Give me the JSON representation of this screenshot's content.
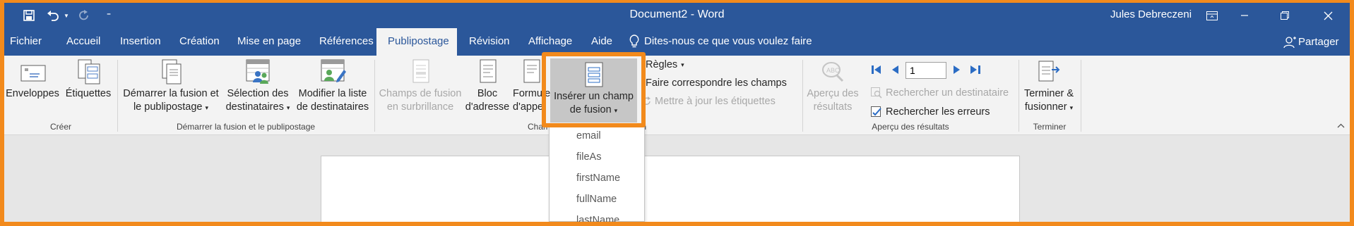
{
  "titlebar": {
    "doc_title": "Document2",
    "separator": "-",
    "app_name": "Word",
    "user": "Jules Debreczeni",
    "qat_customize": "⁼"
  },
  "tabs": [
    {
      "label": "Fichier",
      "active": false
    },
    {
      "label": "Accueil",
      "active": false
    },
    {
      "label": "Insertion",
      "active": false
    },
    {
      "label": "Création",
      "active": false
    },
    {
      "label": "Mise en page",
      "active": false
    },
    {
      "label": "Références",
      "active": false
    },
    {
      "label": "Publipostage",
      "active": true
    },
    {
      "label": "Révision",
      "active": false
    },
    {
      "label": "Affichage",
      "active": false
    },
    {
      "label": "Aide",
      "active": false
    }
  ],
  "tell_me": "Dites-nous ce que vous voulez faire",
  "share": "Partager",
  "ribbon": {
    "groups": {
      "creer": "Créer",
      "demarrer": "Démarrer la fusion et le publipostage",
      "champs": "Champs d'écriture et d'insertion",
      "apercu": "Aperçu des résultats",
      "terminer": "Terminer"
    },
    "enveloppes": "Enveloppes",
    "etiquettes": "Étiquettes",
    "demarrer_l1": "Démarrer la fusion et",
    "demarrer_l2": "le publipostage",
    "selection_l1": "Sélection des",
    "selection_l2": "destinataires",
    "modifier_l1": "Modifier la liste",
    "modifier_l2": "de destinataires",
    "champs_l1": "Champs de fusion",
    "champs_l2": "en surbrillance",
    "bloc_l1": "Bloc",
    "bloc_l2": "d'adresse",
    "formule_l1": "Formule",
    "formule_l2": "d'appel",
    "inserer_l1": "Insérer un champ",
    "inserer_l2": "de fusion",
    "regles": "Règles",
    "faire_correspondre": "Faire correspondre les champs",
    "mettre_a_jour": "Mettre à jour les étiquettes",
    "apercu_l1": "Aperçu des",
    "apercu_l2": "résultats",
    "record_value": "1",
    "rechercher_dest": "Rechercher un destinataire",
    "rechercher_erreurs": "Rechercher les erreurs",
    "terminer_l1": "Terminer &",
    "terminer_l2": "fusionner"
  },
  "dropdown": {
    "items": [
      "email",
      "fileAs",
      "firstName",
      "fullName",
      "lastName"
    ]
  },
  "colors": {
    "word_blue": "#2b579a",
    "highlight_orange": "#f28a1c",
    "ribbon_bg": "#f3f3f3"
  }
}
